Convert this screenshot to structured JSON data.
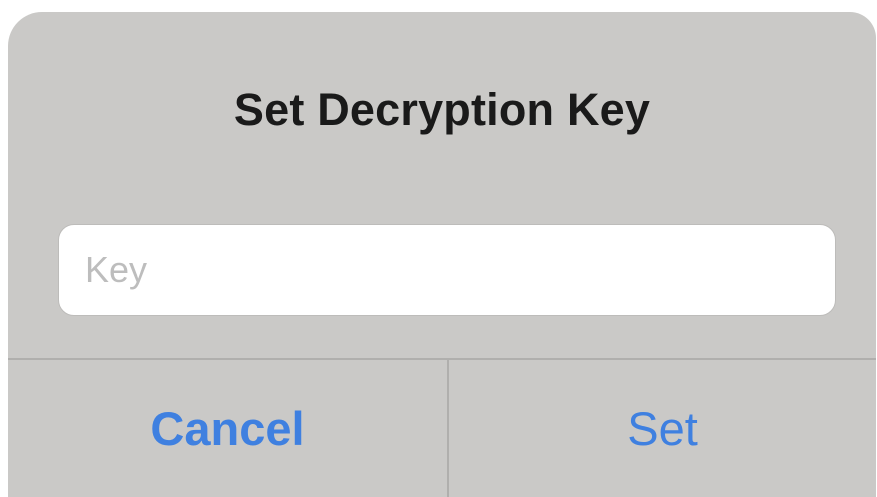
{
  "dialog": {
    "title": "Set Decryption Key",
    "input": {
      "placeholder": "Key",
      "value": ""
    },
    "buttons": {
      "cancel_label": "Cancel",
      "set_label": "Set"
    }
  },
  "colors": {
    "dialog_background": "#cac9c7",
    "button_text": "#3f80e0",
    "title_text": "#1a1a1a",
    "placeholder_text": "#bdbdbd"
  }
}
